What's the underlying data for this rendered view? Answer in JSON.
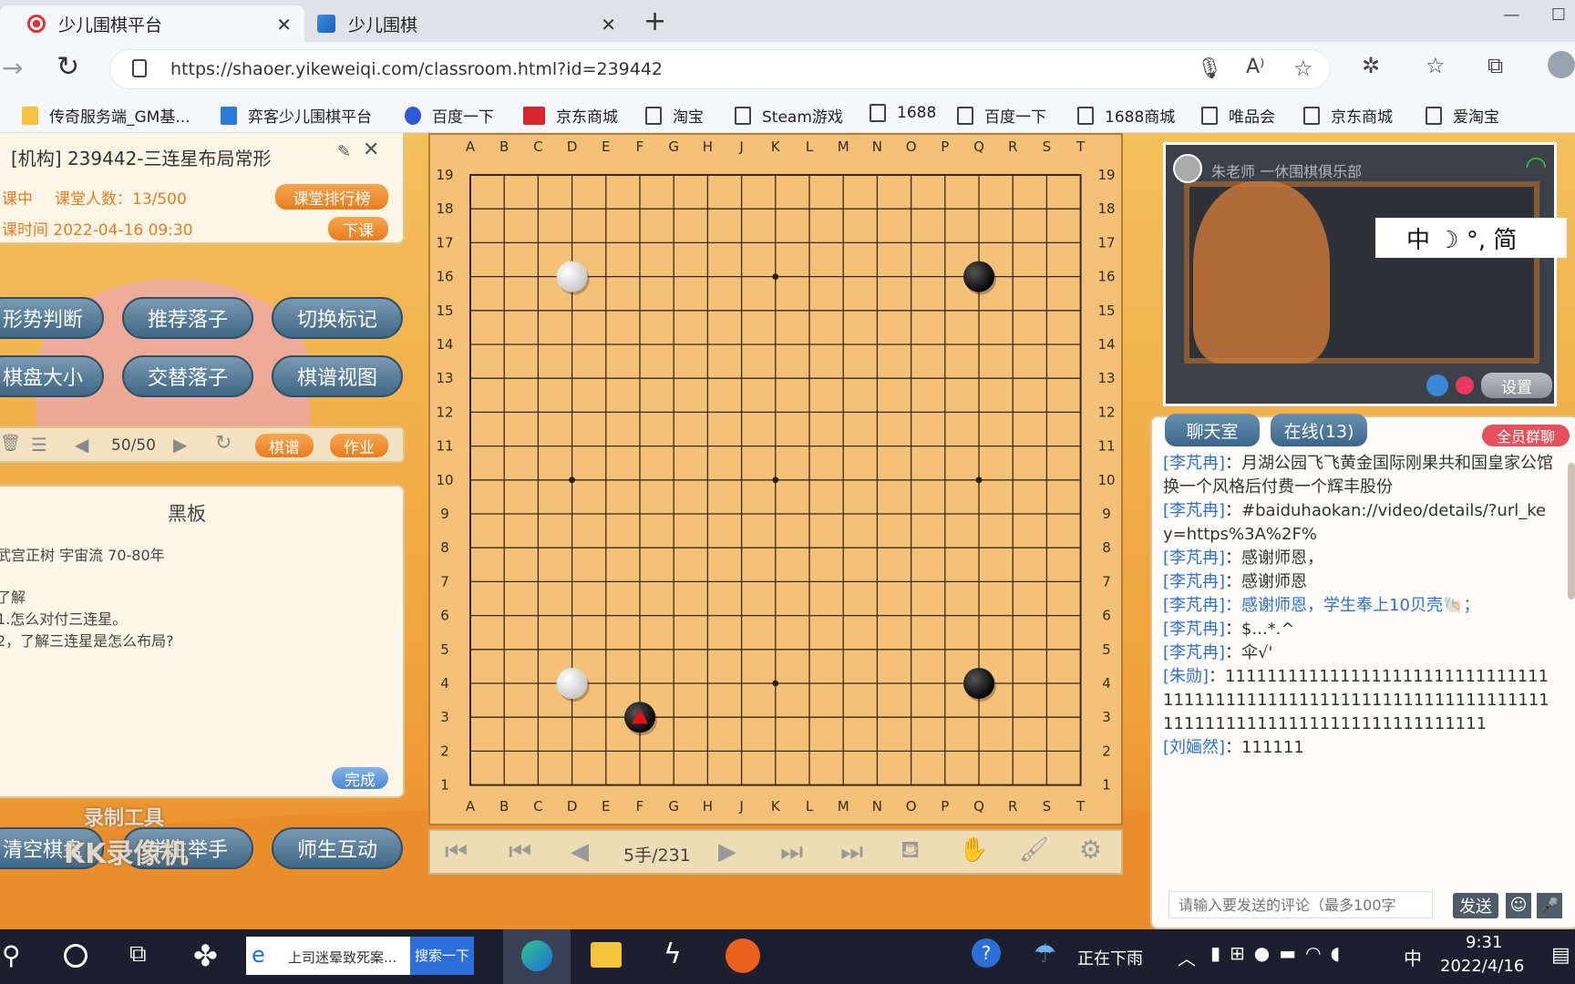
{
  "browser": {
    "tabs": [
      {
        "label": "少儿围棋平台"
      },
      {
        "label": "少儿围棋"
      }
    ],
    "url": "https://shaoer.yikeweiqi.com/classroom.html?id=239442",
    "bookmarks": [
      "传奇服务端_GM基...",
      "弈客少儿围棋平台",
      "百度一下",
      "京东商城",
      "淘宝",
      "Steam游戏",
      "1688",
      "百度一下",
      "1688商城",
      "唯品会",
      "京东商城",
      "爱淘宝"
    ]
  },
  "classroom": {
    "title": "[机构] 239442-三连星布局常形",
    "status": "课中",
    "count_label": "课堂人数：13/500",
    "time_label": "课时间 2022-04-16 09:30",
    "rank_button": "课堂排行榜",
    "end_button": "下课"
  },
  "tools": {
    "row1": [
      "形势判断",
      "推荐落子",
      "切换标记"
    ],
    "row2": [
      "棋盘大小",
      "交替落子",
      "棋谱视图"
    ],
    "row3": [
      "清空棋盘",
      "学生举手",
      "师生互动"
    ]
  },
  "nav": {
    "counter": "50/50",
    "record_button": "棋谱",
    "homework_button": "作业"
  },
  "blackboard": {
    "title": "黑板",
    "line1": "武宫正树  宇宙流   70-80年",
    "line2": "了解",
    "line3": "1.怎么对付三连星。",
    "line4": "2，了解三连星是怎么布局?",
    "done_button": "完成"
  },
  "watermark": {
    "line1": "录制工具",
    "line2": "KK录像机"
  },
  "board": {
    "columns": [
      "A",
      "B",
      "C",
      "D",
      "E",
      "F",
      "G",
      "H",
      "J",
      "K",
      "L",
      "M",
      "N",
      "O",
      "P",
      "Q",
      "R",
      "S",
      "T"
    ],
    "rows": [
      "19",
      "18",
      "17",
      "16",
      "15",
      "14",
      "13",
      "12",
      "11",
      "10",
      "9",
      "8",
      "7",
      "6",
      "5",
      "4",
      "3",
      "2",
      "1"
    ],
    "stones": [
      {
        "color": "white",
        "pos": "D16"
      },
      {
        "color": "black",
        "pos": "Q16"
      },
      {
        "color": "white",
        "pos": "D4"
      },
      {
        "color": "black",
        "pos": "Q4"
      },
      {
        "color": "black",
        "pos": "F3",
        "last": true
      }
    ],
    "move_counter": "5手/231"
  },
  "video": {
    "teacher": "朱老师 一休围棋俱乐部",
    "settings_button": "设置",
    "ime": "中 ☽ °, 简"
  },
  "chat": {
    "tab_chat": "聊天室",
    "tab_online": "在线(13)",
    "group_button": "全员群聊",
    "messages": [
      {
        "who": "[李芃冉]",
        "text": "：月湖公园飞飞黄金国际刚果共和国皇家公馆换一个风格后付费一个辉丰股份"
      },
      {
        "who": "[李芃冉]",
        "text": "：#baiduhaokan://video/details/?url_key=https%3A%2F%"
      },
      {
        "who": "[李芃冉]",
        "text": "：感谢师恩，"
      },
      {
        "who": "[李芃冉]",
        "text": "：感谢师恩"
      },
      {
        "who": "[李芃冉]",
        "text": "：感谢师恩，学生奉上10贝壳🐚；",
        "highlight": true
      },
      {
        "who": "[李芃冉]",
        "text": "：$...*.^"
      },
      {
        "who": "[李芃冉]",
        "text": "：伞√'"
      },
      {
        "who": "[朱勋]",
        "text": "：111111111111111111111111111111111111111111111111111111111111111111111111111111111111111111111111111"
      },
      {
        "who": "[刘婳然]",
        "text": "：111111"
      }
    ],
    "input_placeholder": "请输入要发送的评论（最多100字",
    "send_button": "发送"
  },
  "taskbar": {
    "search_app": "上司迷晕致死案...",
    "search_button": "搜索一下",
    "weather": "正在下雨",
    "ime": "中",
    "time": "9:31",
    "date": "2022/4/16"
  },
  "colors": {
    "accent": "#e77d1f",
    "pill": "#3f6786",
    "chat_name": "#2f6fcf"
  }
}
